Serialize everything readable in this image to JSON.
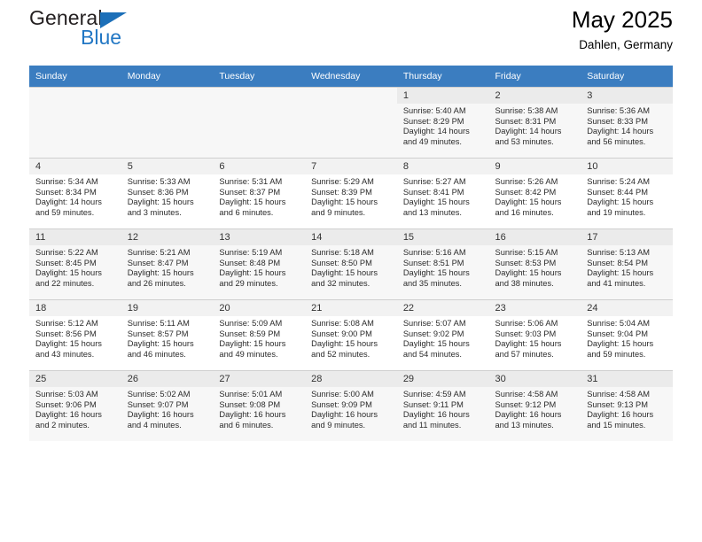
{
  "brand": {
    "name_top": "General",
    "name_bottom": "Blue",
    "triangle_color": "#1c6fb8",
    "blue_color": "#2277c4"
  },
  "header": {
    "title": "May 2025",
    "subtitle": "Dahlen, Germany"
  },
  "theme": {
    "header_bg": "#3b7dc0",
    "header_text": "#ffffff",
    "band_bg": "#f7f7f7",
    "daynum_bg": "#f2f2f2",
    "grid_line": "#cfcfcf"
  },
  "weekdays": [
    "Sunday",
    "Monday",
    "Tuesday",
    "Wednesday",
    "Thursday",
    "Friday",
    "Saturday"
  ],
  "labels": {
    "sunrise": "Sunrise:",
    "sunset": "Sunset:",
    "daylight": "Daylight:"
  },
  "weeks": [
    [
      {
        "day": "",
        "sunrise": "",
        "sunset": "",
        "daylight": ""
      },
      {
        "day": "",
        "sunrise": "",
        "sunset": "",
        "daylight": ""
      },
      {
        "day": "",
        "sunrise": "",
        "sunset": "",
        "daylight": ""
      },
      {
        "day": "",
        "sunrise": "",
        "sunset": "",
        "daylight": ""
      },
      {
        "day": "1",
        "sunrise": "Sunrise: 5:40 AM",
        "sunset": "Sunset: 8:29 PM",
        "daylight": "Daylight: 14 hours and 49 minutes."
      },
      {
        "day": "2",
        "sunrise": "Sunrise: 5:38 AM",
        "sunset": "Sunset: 8:31 PM",
        "daylight": "Daylight: 14 hours and 53 minutes."
      },
      {
        "day": "3",
        "sunrise": "Sunrise: 5:36 AM",
        "sunset": "Sunset: 8:33 PM",
        "daylight": "Daylight: 14 hours and 56 minutes."
      }
    ],
    [
      {
        "day": "4",
        "sunrise": "Sunrise: 5:34 AM",
        "sunset": "Sunset: 8:34 PM",
        "daylight": "Daylight: 14 hours and 59 minutes."
      },
      {
        "day": "5",
        "sunrise": "Sunrise: 5:33 AM",
        "sunset": "Sunset: 8:36 PM",
        "daylight": "Daylight: 15 hours and 3 minutes."
      },
      {
        "day": "6",
        "sunrise": "Sunrise: 5:31 AM",
        "sunset": "Sunset: 8:37 PM",
        "daylight": "Daylight: 15 hours and 6 minutes."
      },
      {
        "day": "7",
        "sunrise": "Sunrise: 5:29 AM",
        "sunset": "Sunset: 8:39 PM",
        "daylight": "Daylight: 15 hours and 9 minutes."
      },
      {
        "day": "8",
        "sunrise": "Sunrise: 5:27 AM",
        "sunset": "Sunset: 8:41 PM",
        "daylight": "Daylight: 15 hours and 13 minutes."
      },
      {
        "day": "9",
        "sunrise": "Sunrise: 5:26 AM",
        "sunset": "Sunset: 8:42 PM",
        "daylight": "Daylight: 15 hours and 16 minutes."
      },
      {
        "day": "10",
        "sunrise": "Sunrise: 5:24 AM",
        "sunset": "Sunset: 8:44 PM",
        "daylight": "Daylight: 15 hours and 19 minutes."
      }
    ],
    [
      {
        "day": "11",
        "sunrise": "Sunrise: 5:22 AM",
        "sunset": "Sunset: 8:45 PM",
        "daylight": "Daylight: 15 hours and 22 minutes."
      },
      {
        "day": "12",
        "sunrise": "Sunrise: 5:21 AM",
        "sunset": "Sunset: 8:47 PM",
        "daylight": "Daylight: 15 hours and 26 minutes."
      },
      {
        "day": "13",
        "sunrise": "Sunrise: 5:19 AM",
        "sunset": "Sunset: 8:48 PM",
        "daylight": "Daylight: 15 hours and 29 minutes."
      },
      {
        "day": "14",
        "sunrise": "Sunrise: 5:18 AM",
        "sunset": "Sunset: 8:50 PM",
        "daylight": "Daylight: 15 hours and 32 minutes."
      },
      {
        "day": "15",
        "sunrise": "Sunrise: 5:16 AM",
        "sunset": "Sunset: 8:51 PM",
        "daylight": "Daylight: 15 hours and 35 minutes."
      },
      {
        "day": "16",
        "sunrise": "Sunrise: 5:15 AM",
        "sunset": "Sunset: 8:53 PM",
        "daylight": "Daylight: 15 hours and 38 minutes."
      },
      {
        "day": "17",
        "sunrise": "Sunrise: 5:13 AM",
        "sunset": "Sunset: 8:54 PM",
        "daylight": "Daylight: 15 hours and 41 minutes."
      }
    ],
    [
      {
        "day": "18",
        "sunrise": "Sunrise: 5:12 AM",
        "sunset": "Sunset: 8:56 PM",
        "daylight": "Daylight: 15 hours and 43 minutes."
      },
      {
        "day": "19",
        "sunrise": "Sunrise: 5:11 AM",
        "sunset": "Sunset: 8:57 PM",
        "daylight": "Daylight: 15 hours and 46 minutes."
      },
      {
        "day": "20",
        "sunrise": "Sunrise: 5:09 AM",
        "sunset": "Sunset: 8:59 PM",
        "daylight": "Daylight: 15 hours and 49 minutes."
      },
      {
        "day": "21",
        "sunrise": "Sunrise: 5:08 AM",
        "sunset": "Sunset: 9:00 PM",
        "daylight": "Daylight: 15 hours and 52 minutes."
      },
      {
        "day": "22",
        "sunrise": "Sunrise: 5:07 AM",
        "sunset": "Sunset: 9:02 PM",
        "daylight": "Daylight: 15 hours and 54 minutes."
      },
      {
        "day": "23",
        "sunrise": "Sunrise: 5:06 AM",
        "sunset": "Sunset: 9:03 PM",
        "daylight": "Daylight: 15 hours and 57 minutes."
      },
      {
        "day": "24",
        "sunrise": "Sunrise: 5:04 AM",
        "sunset": "Sunset: 9:04 PM",
        "daylight": "Daylight: 15 hours and 59 minutes."
      }
    ],
    [
      {
        "day": "25",
        "sunrise": "Sunrise: 5:03 AM",
        "sunset": "Sunset: 9:06 PM",
        "daylight": "Daylight: 16 hours and 2 minutes."
      },
      {
        "day": "26",
        "sunrise": "Sunrise: 5:02 AM",
        "sunset": "Sunset: 9:07 PM",
        "daylight": "Daylight: 16 hours and 4 minutes."
      },
      {
        "day": "27",
        "sunrise": "Sunrise: 5:01 AM",
        "sunset": "Sunset: 9:08 PM",
        "daylight": "Daylight: 16 hours and 6 minutes."
      },
      {
        "day": "28",
        "sunrise": "Sunrise: 5:00 AM",
        "sunset": "Sunset: 9:09 PM",
        "daylight": "Daylight: 16 hours and 9 minutes."
      },
      {
        "day": "29",
        "sunrise": "Sunrise: 4:59 AM",
        "sunset": "Sunset: 9:11 PM",
        "daylight": "Daylight: 16 hours and 11 minutes."
      },
      {
        "day": "30",
        "sunrise": "Sunrise: 4:58 AM",
        "sunset": "Sunset: 9:12 PM",
        "daylight": "Daylight: 16 hours and 13 minutes."
      },
      {
        "day": "31",
        "sunrise": "Sunrise: 4:58 AM",
        "sunset": "Sunset: 9:13 PM",
        "daylight": "Daylight: 16 hours and 15 minutes."
      }
    ]
  ]
}
